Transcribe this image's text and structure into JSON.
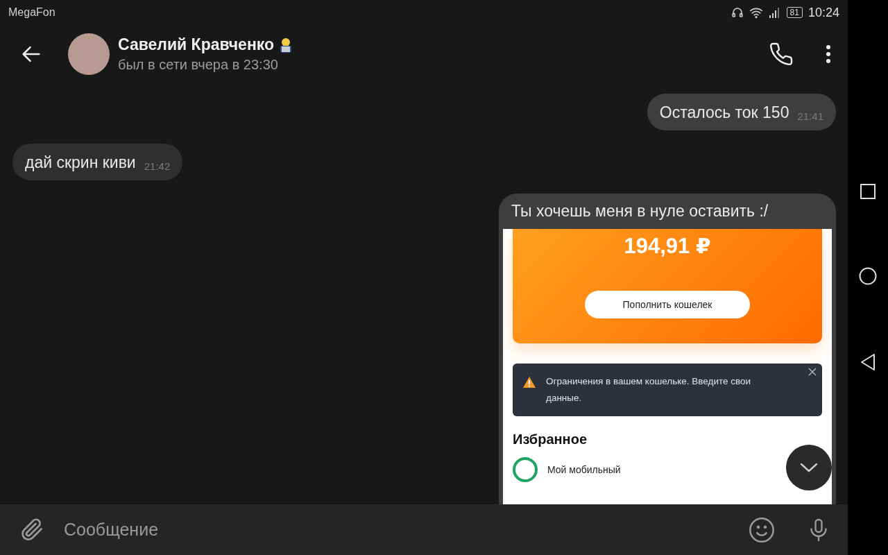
{
  "status_bar": {
    "carrier": "MegaFon",
    "battery": "81",
    "time": "10:24"
  },
  "header": {
    "name": "Савелий Кравченко",
    "last_seen": "был в сети вчера в 23:30"
  },
  "messages": [
    {
      "kind": "text",
      "outgoing": true,
      "text": "Осталось ток 150",
      "time": "21:41"
    },
    {
      "kind": "text",
      "outgoing": false,
      "text": "дай скрин киви",
      "time": "21:42"
    },
    {
      "kind": "image",
      "outgoing": true,
      "text": "Ты хочешь меня в нуле оставить :/",
      "screenshot": {
        "balance": "194,91 ₽",
        "button": "Пополнить кошелек",
        "notice": "Ограничения в вашем кошельке. Введите свои данные.",
        "section": "Избранное",
        "favorite": "Мой мобильный"
      }
    }
  ],
  "composer": {
    "placeholder": "Сообщение"
  }
}
